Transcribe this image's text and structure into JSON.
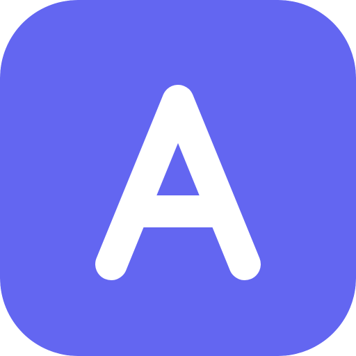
{
  "icon": {
    "letter": "A",
    "colors": {
      "background": "#6366F1",
      "glyph": "#FFFFFF"
    }
  }
}
